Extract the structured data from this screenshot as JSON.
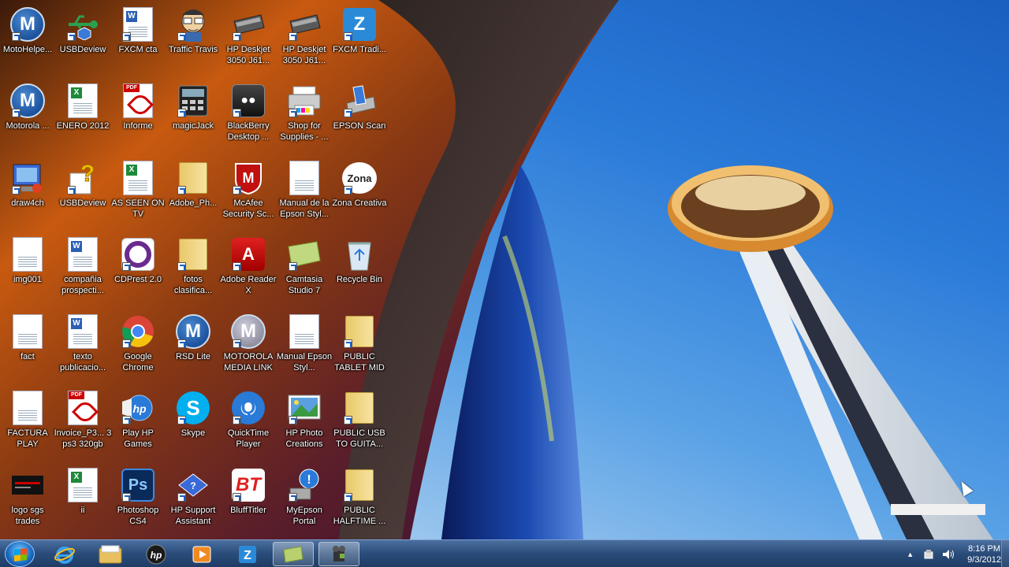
{
  "desktop": {
    "icons": [
      {
        "label": "MotoHelpe...",
        "type": "moto"
      },
      {
        "label": "USBDeview",
        "type": "usb"
      },
      {
        "label": "FXCM cta",
        "type": "doc"
      },
      {
        "label": "Traffic Travis",
        "type": "travis"
      },
      {
        "label": "HP Deskjet 3050 J61...",
        "type": "scanner"
      },
      {
        "label": "HP Deskjet 3050 J61...",
        "type": "scanner"
      },
      {
        "label": "FXCM Tradi...",
        "type": "fxcm"
      },
      {
        "label": "Motorola ...",
        "type": "moto"
      },
      {
        "label": "ENERO 2012",
        "type": "excel"
      },
      {
        "label": "Informe",
        "type": "pdf"
      },
      {
        "label": "magicJack",
        "type": "magicjack"
      },
      {
        "label": "BlackBerry Desktop ...",
        "type": "blackberry"
      },
      {
        "label": "Shop for Supplies - ...",
        "type": "printer"
      },
      {
        "label": "EPSON Scan",
        "type": "epson"
      },
      {
        "label": "draw4ch",
        "type": "draw"
      },
      {
        "label": "USBDeview",
        "type": "question"
      },
      {
        "label": "AS SEEN ON TV",
        "type": "excel"
      },
      {
        "label": "Adobe_Ph...",
        "type": "folder"
      },
      {
        "label": "McAfee Security Sc...",
        "type": "mcafee"
      },
      {
        "label": "Manual de la Epson Styl...",
        "type": "blank"
      },
      {
        "label": "Zona Creativa",
        "type": "zona"
      },
      {
        "label": "img001",
        "type": "blank"
      },
      {
        "label": "compañia prospecti...",
        "type": "word"
      },
      {
        "label": "CDPrest 2.0",
        "type": "cdprest"
      },
      {
        "label": "fotos clasifica...",
        "type": "folder"
      },
      {
        "label": "Adobe Reader X",
        "type": "reader"
      },
      {
        "label": "Camtasia Studio 7",
        "type": "camtasia"
      },
      {
        "label": "Recycle Bin",
        "type": "recycle"
      },
      {
        "label": "fact",
        "type": "blank"
      },
      {
        "label": "texto publicacio...",
        "type": "word"
      },
      {
        "label": "Google Chrome",
        "type": "chrome"
      },
      {
        "label": "RSD Lite",
        "type": "moto"
      },
      {
        "label": "MOTOROLA MEDIA LINK",
        "type": "motogrey"
      },
      {
        "label": "Manual Epson Styl...",
        "type": "blank"
      },
      {
        "label": "PUBLIC TABLET MID",
        "type": "folder"
      },
      {
        "label": "FACTURA PLAY",
        "type": "blank"
      },
      {
        "label": "Invoice_P3... 3 ps3 320gb",
        "type": "pdf"
      },
      {
        "label": "Play HP Games",
        "type": "hpgames"
      },
      {
        "label": "Skype",
        "type": "skype"
      },
      {
        "label": "QuickTime Player",
        "type": "quicktime"
      },
      {
        "label": "HP Photo Creations",
        "type": "hpphoto"
      },
      {
        "label": "PUBLIC USB TO GUITA...",
        "type": "folder"
      },
      {
        "label": "logo sgs trades",
        "type": "logo"
      },
      {
        "label": "ii",
        "type": "excel"
      },
      {
        "label": "Photoshop CS4",
        "type": "photoshop"
      },
      {
        "label": "HP Support Assistant",
        "type": "hpsupport"
      },
      {
        "label": "BluffTitler",
        "type": "bluff"
      },
      {
        "label": "MyEpson Portal",
        "type": "myepson"
      },
      {
        "label": "PUBLIC HALFTIME ...",
        "type": "folder"
      }
    ]
  },
  "taskbar": {
    "start_label": "Start",
    "pinned": [
      {
        "name": "internet-explorer",
        "icon": "ie-icon"
      },
      {
        "name": "windows-explorer",
        "icon": "folder-icon"
      },
      {
        "name": "hp",
        "icon": "hp-icon"
      },
      {
        "name": "media-player",
        "icon": "media-player-icon"
      },
      {
        "name": "fxcm",
        "icon": "fxcm-icon"
      },
      {
        "name": "camtasia",
        "icon": "camtasia-icon"
      },
      {
        "name": "camtasia-recorder",
        "icon": "recorder-icon"
      }
    ],
    "tray": {
      "time": "8:16 PM",
      "date": "9/3/2012"
    }
  }
}
